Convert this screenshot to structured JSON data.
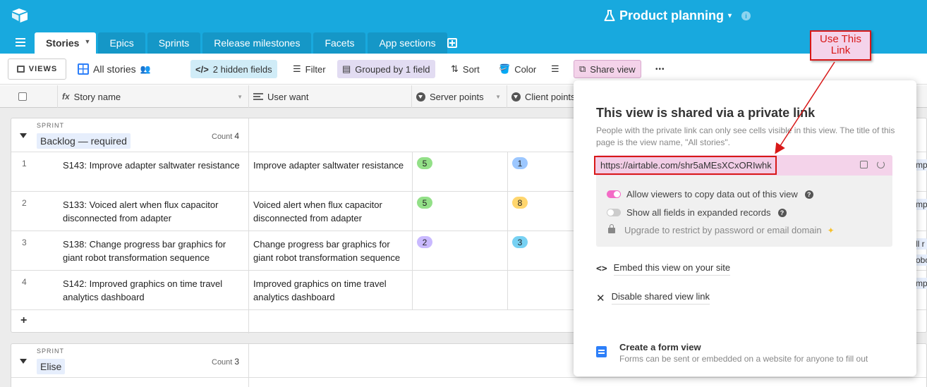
{
  "header": {
    "base_title": "Product planning",
    "caret": "▾",
    "info": "i"
  },
  "tabs": [
    {
      "label": "Stories",
      "active": true
    },
    {
      "label": "Epics"
    },
    {
      "label": "Sprints"
    },
    {
      "label": "Release milestones"
    },
    {
      "label": "Facets"
    },
    {
      "label": "App sections"
    }
  ],
  "toolbar": {
    "views_label": "VIEWS",
    "view_name": "All stories",
    "hidden_fields": "2 hidden fields",
    "filter": "Filter",
    "grouped": "Grouped by 1 field",
    "sort": "Sort",
    "color": "Color",
    "share_view": "Share view",
    "more": "•••"
  },
  "columns": {
    "story_name": "Story name",
    "user_want": "User want",
    "server_points": "Server points",
    "client_points": "Client points"
  },
  "groups": [
    {
      "label": "SPRINT",
      "name": "Backlog — required",
      "count_label": "Count",
      "count": "4",
      "rows": [
        {
          "num": "1",
          "story": "S143: Improve adapter saltwater resistance",
          "want": "Improve adapter saltwater resistance",
          "server": "5",
          "client": "1"
        },
        {
          "num": "2",
          "story": "S133: Voiced alert when flux capacitor disconnected from adapter",
          "want": "Voiced alert when flux capacitor disconnected from adapter",
          "server": "5",
          "client": "8"
        },
        {
          "num": "3",
          "story": "S138: Change progress bar graphics for giant robot transformation sequence",
          "want": "Change progress bar graphics for giant robot transformation sequence",
          "server": "2",
          "client": "3"
        },
        {
          "num": "4",
          "story": "S142: Improved graphics on time travel analytics dashboard",
          "want": "Improved graphics on time travel analytics dashboard",
          "server": "",
          "client": ""
        }
      ],
      "add": "+"
    },
    {
      "label": "SPRINT",
      "name": "Elise",
      "count_label": "Count",
      "count": "3"
    }
  ],
  "share_popover": {
    "title": "This view is shared via a private link",
    "description": "People with the private link can only see cells visible in this view. The title of this page is the view name, \"All stories\".",
    "url": "https://airtable.com/shr5aMEsXCxORIwhk",
    "option_copy": "Allow viewers to copy data out of this view",
    "option_fields": "Show all fields in expanded records",
    "option_upgrade": "Upgrade to restrict by password or email domain",
    "embed": "Embed this view on your site",
    "disable": "Disable shared view link",
    "form_title": "Create a form view",
    "form_desc": "Forms can be sent or embedded on a website for anyone to fill out",
    "help": "?"
  },
  "annotation": {
    "text": "Use This Link"
  },
  "peek": {
    "a": "mpl",
    "b": "mp",
    "c": "ll r",
    "d": "obo",
    "e": "mp"
  },
  "colors": {
    "brand": "#18a9de",
    "share_pill": "#f4d3ea",
    "annotation_red": "#d81818"
  }
}
